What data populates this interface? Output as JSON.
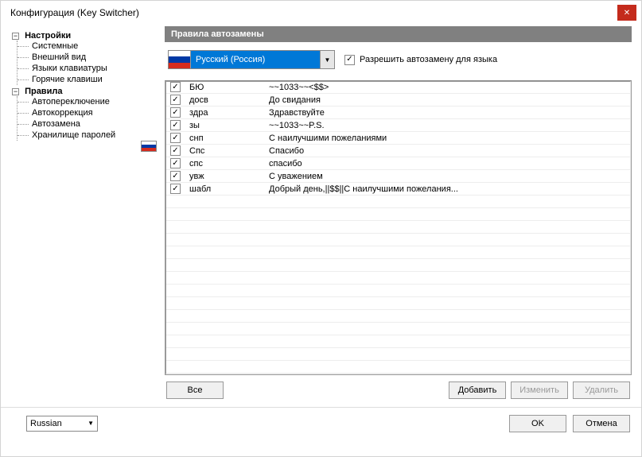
{
  "window": {
    "title": "Конфигурация (Key Switcher)"
  },
  "tree": {
    "groups": [
      {
        "label": "Настройки",
        "items": [
          "Системные",
          "Внешний вид",
          "Языки клавиатуры",
          "Горячие клавиши"
        ]
      },
      {
        "label": "Правила",
        "items": [
          "Автопереключение",
          "Автокоррекция",
          "Автозамена",
          "Хранилище паролей"
        ]
      }
    ]
  },
  "panel": {
    "header": "Правила автозамены",
    "language": "Русский (Россия)",
    "enable_label": "Разрешить автозамену для языка"
  },
  "rules": [
    {
      "key": "БЮ",
      "value": "~~1033~~<$$>"
    },
    {
      "key": "досв",
      "value": "До свидания"
    },
    {
      "key": "здра",
      "value": "Здравствуйте"
    },
    {
      "key": "зы",
      "value": "~~1033~~P.S."
    },
    {
      "key": "снп",
      "value": "С наилучшими пожеланиями"
    },
    {
      "key": "Спс",
      "value": "Спасибо"
    },
    {
      "key": "спс",
      "value": "спасибо"
    },
    {
      "key": "увж",
      "value": "С уважением"
    },
    {
      "key": "шабл",
      "value": "Добрый день,||$$||С наилучшими пожелания..."
    }
  ],
  "buttons": {
    "all": "Все",
    "add": "Добавить",
    "edit": "Изменить",
    "delete": "Удалить",
    "ok": "OK",
    "cancel": "Отмена"
  },
  "bottom": {
    "language": "Russian"
  },
  "colors": {
    "flag_white": "#ffffff",
    "flag_blue": "#0039a6",
    "flag_red": "#d52b1e",
    "selection": "#0078d7"
  }
}
